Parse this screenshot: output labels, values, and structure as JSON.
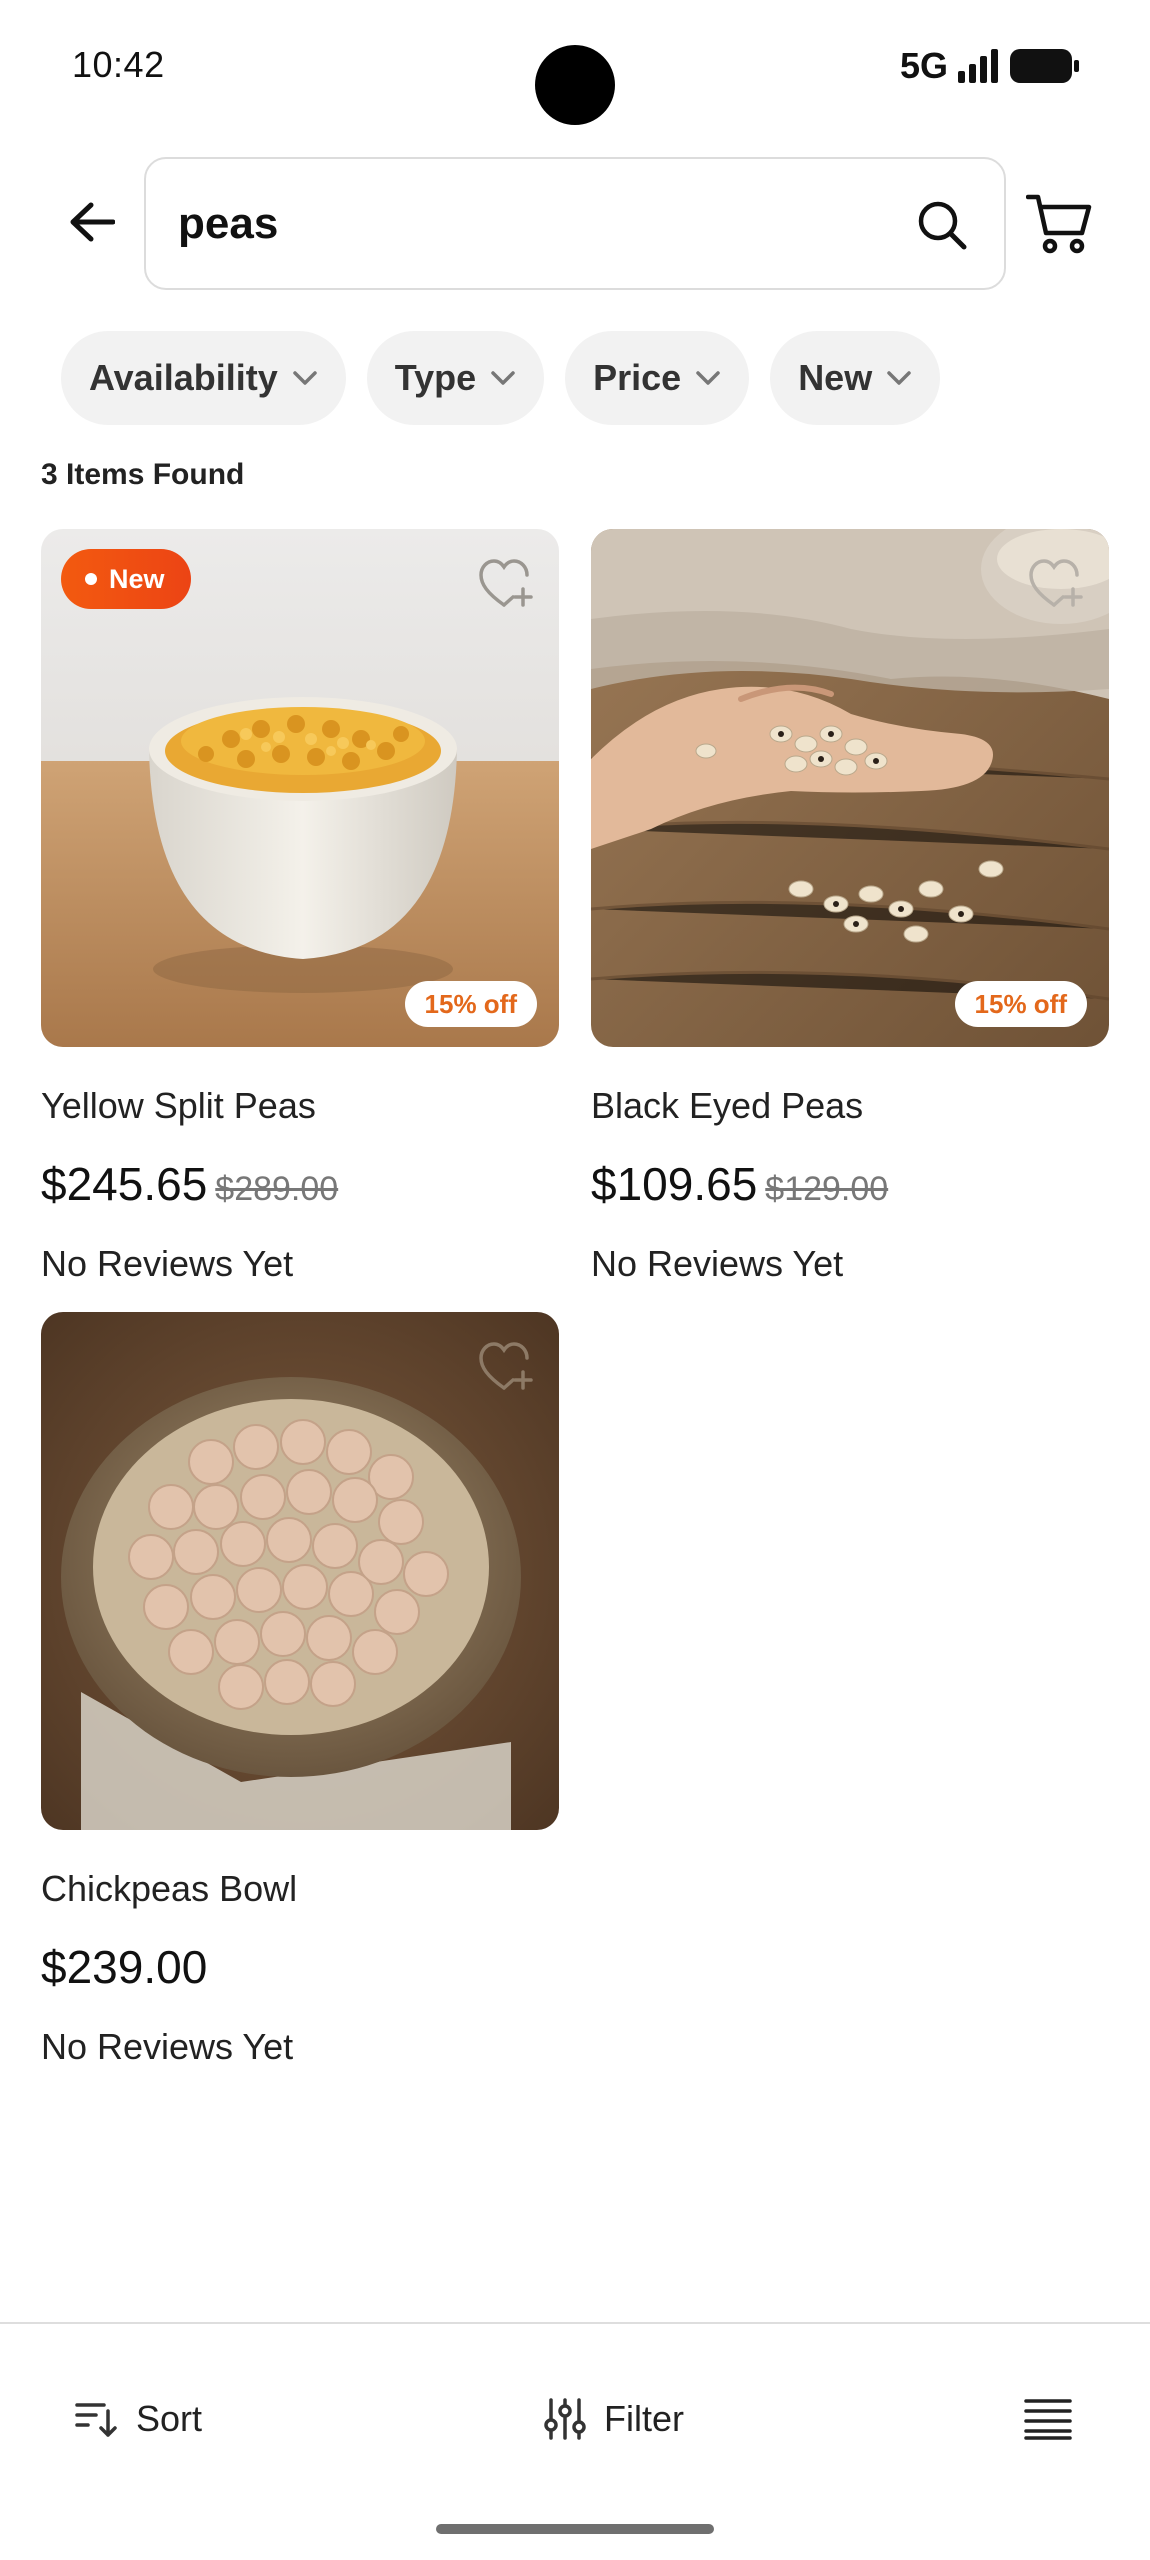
{
  "status_bar": {
    "time": "10:42",
    "network": "5G"
  },
  "search": {
    "query": "peas"
  },
  "filters": [
    {
      "label": "Availability"
    },
    {
      "label": "Type"
    },
    {
      "label": "Price"
    },
    {
      "label": "New"
    }
  ],
  "results": {
    "count_label": "3 Items Found"
  },
  "products": [
    {
      "title": "Yellow Split Peas",
      "price": "$245.65",
      "old_price": "$289.00",
      "discount": "15% off",
      "badge": "New",
      "reviews": "No Reviews Yet"
    },
    {
      "title": "Black Eyed Peas",
      "price": "$109.65",
      "old_price": "$129.00",
      "discount": "15% off",
      "reviews": "No Reviews Yet"
    },
    {
      "title": "Chickpeas Bowl",
      "price": "$239.00",
      "reviews": "No Reviews Yet"
    }
  ],
  "bottom_bar": {
    "sort_label": "Sort",
    "filter_label": "Filter"
  },
  "colors": {
    "badge_new": "#f0501a",
    "discount_text": "#e3681b",
    "chip_bg": "#f2f2f2"
  }
}
